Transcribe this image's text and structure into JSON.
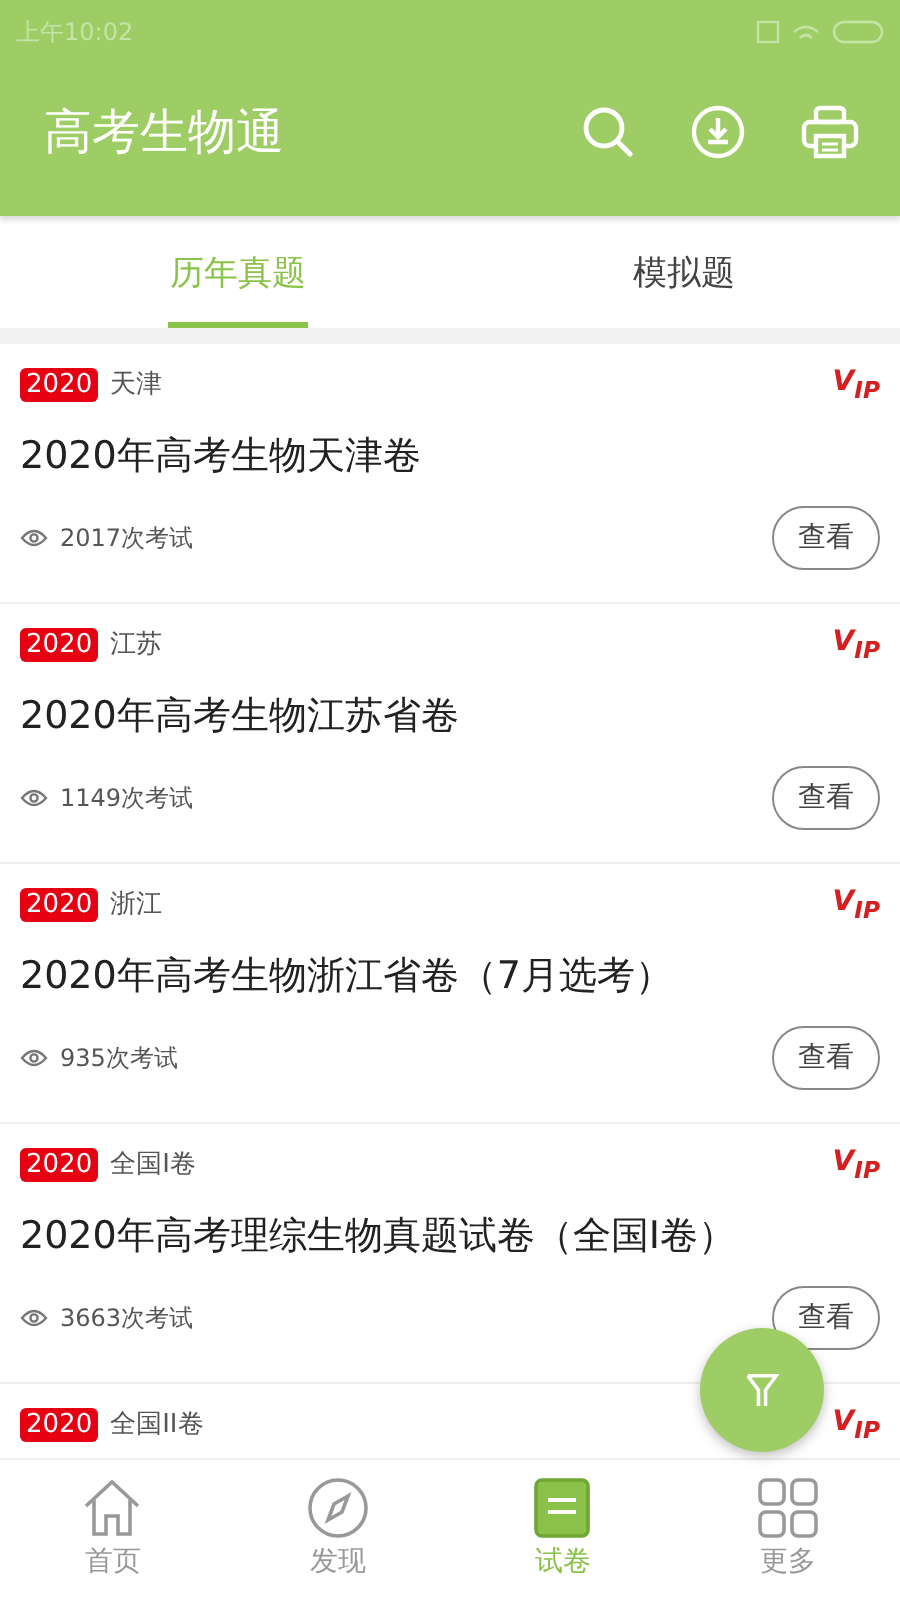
{
  "status_bar": {
    "time": "上午10:02"
  },
  "app_bar": {
    "title": "高考生物通"
  },
  "tabs": [
    {
      "label": "历年真题",
      "selected": true
    },
    {
      "label": "模拟题",
      "selected": false
    }
  ],
  "papers": [
    {
      "year": "2020",
      "region": "天津",
      "badge": "V$_{IP}$",
      "title": "2020年高考生物天津卷",
      "views": "2017次考试",
      "action": "查看"
    },
    {
      "year": "2020",
      "region": "江苏",
      "badge": "V$_{IP}$",
      "title": "2020年高考生物江苏省卷",
      "views": "1149次考试",
      "action": "查看"
    },
    {
      "year": "2020",
      "region": "浙江",
      "badge": "V$_{IP}$",
      "title": "2020年高考生物浙江省卷（7月选考）",
      "views": "935次考试",
      "action": "查看"
    },
    {
      "year": "2020",
      "region": "全国I卷",
      "badge": "V$_{IP}$",
      "title": "2020年高考理综生物真题试卷（全国I卷）",
      "views": "3663次考试",
      "action": "查看"
    },
    {
      "year": "2020",
      "region": "全国II卷",
      "badge": "V$_{IP}$"
    }
  ],
  "bottom_nav": [
    {
      "kind": "home",
      "label": "首页",
      "selected": false
    },
    {
      "kind": "compass",
      "label": "发现",
      "selected": false
    },
    {
      "kind": "paper",
      "label": "试卷",
      "selected": true
    },
    {
      "kind": "grid",
      "label": "更多",
      "selected": false
    }
  ]
}
